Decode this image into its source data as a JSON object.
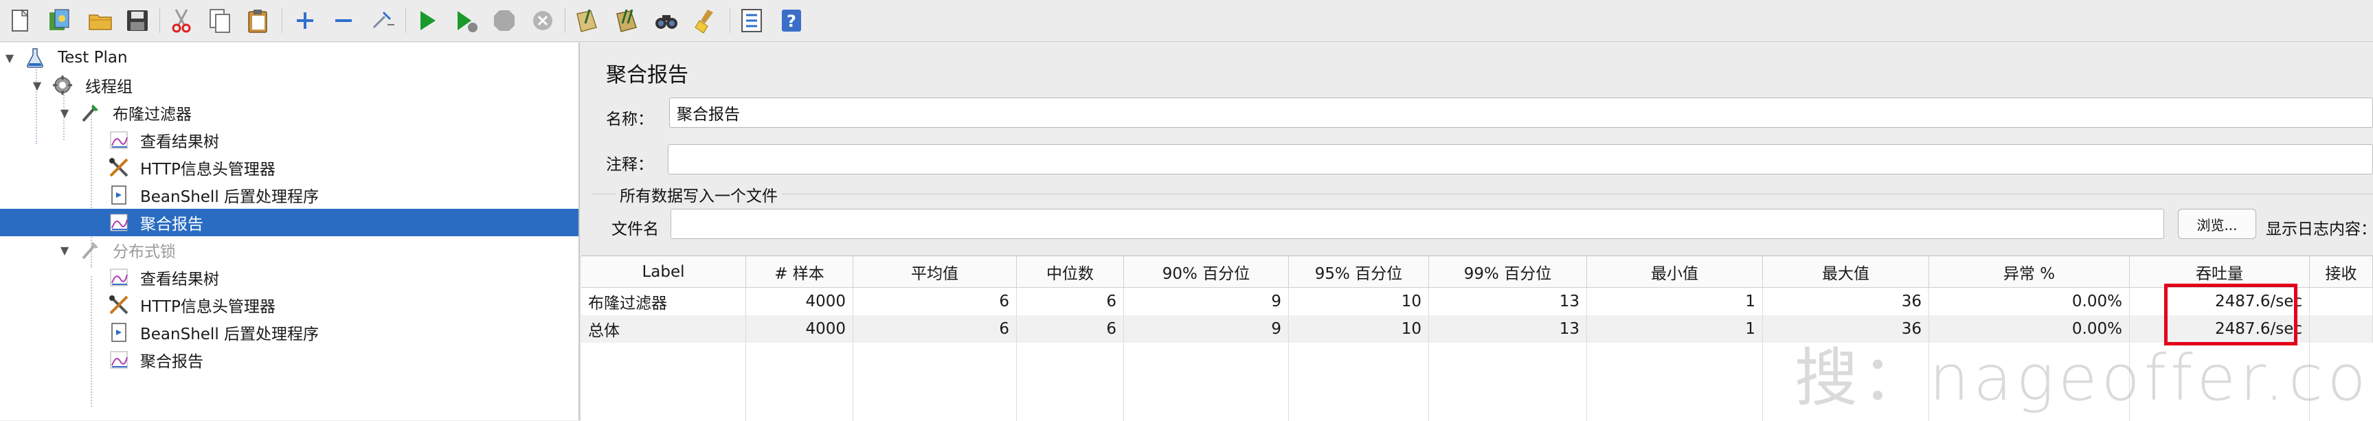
{
  "toolbar": {
    "buttons": [
      {
        "name": "new-icon"
      },
      {
        "name": "templates-icon"
      },
      {
        "name": "open-icon"
      },
      {
        "name": "save-icon"
      },
      {
        "name": "cut-icon"
      },
      {
        "name": "copy-icon"
      },
      {
        "name": "paste-icon"
      },
      {
        "name": "expand-icon"
      },
      {
        "name": "collapse-icon"
      },
      {
        "name": "toggle-icon"
      },
      {
        "name": "start-icon"
      },
      {
        "name": "start-no-pauses-icon"
      },
      {
        "name": "stop-icon"
      },
      {
        "name": "shutdown-icon"
      },
      {
        "name": "clear-icon"
      },
      {
        "name": "clear-all-icon"
      },
      {
        "name": "search-icon"
      },
      {
        "name": "reset-search-icon"
      },
      {
        "name": "function-helper-icon"
      },
      {
        "name": "help-icon"
      }
    ]
  },
  "tree": {
    "items": [
      {
        "label": "Test Plan"
      },
      {
        "label": "线程组"
      },
      {
        "label": "布隆过滤器"
      },
      {
        "label": "查看结果树"
      },
      {
        "label": "HTTP信息头管理器"
      },
      {
        "label": "BeanShell 后置处理程序"
      },
      {
        "label": "聚合报告"
      },
      {
        "label": "分布式锁"
      },
      {
        "label": "查看结果树"
      },
      {
        "label": "HTTP信息头管理器"
      },
      {
        "label": "BeanShell 后置处理程序"
      },
      {
        "label": "聚合报告"
      }
    ]
  },
  "panel": {
    "title": "聚合报告",
    "name_label": "名称：",
    "name_value": "聚合报告",
    "comment_label": "注释：",
    "comment_value": "",
    "file_group_label": "所有数据写入一个文件",
    "filename_label": "文件名",
    "filename_value": "",
    "browse_label": "浏览...",
    "log_label": "显示日志内容："
  },
  "table": {
    "headers": [
      "Label",
      "# 样本",
      "平均值",
      "中位数",
      "90% 百分位",
      "95% 百分位",
      "99% 百分位",
      "最小值",
      "最大值",
      "异常 %",
      "吞吐量",
      "接收"
    ],
    "rows": [
      [
        "布隆过滤器",
        "4000",
        "6",
        "6",
        "9",
        "10",
        "13",
        "1",
        "36",
        "0.00%",
        "2487.6/sec",
        ""
      ],
      [
        "总体",
        "4000",
        "6",
        "6",
        "9",
        "10",
        "13",
        "1",
        "36",
        "0.00%",
        "2487.6/sec",
        ""
      ]
    ]
  },
  "watermark": "搜：nageoffer.com",
  "colors": {
    "selection": "#2a6cc2",
    "highlight": "#e3001b"
  }
}
